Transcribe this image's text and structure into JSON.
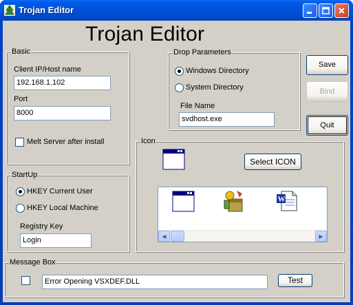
{
  "window": {
    "title": "Trojan Editor"
  },
  "header": {
    "title": "Trojan Editor"
  },
  "basic": {
    "group_label": "Basic",
    "host_label": "Client IP/Host name",
    "host_value": "192.168.1.102",
    "port_label": "Port",
    "port_value": "8000",
    "melt_label": "Melt Server after install",
    "melt_checked": false
  },
  "drop": {
    "group_label": "Drop Parameters",
    "options": [
      "Windows Directory",
      "System Directory"
    ],
    "selected": "Windows Directory",
    "filename_label": "File Name",
    "filename_value": "svdhost.exe"
  },
  "actions": {
    "save": "Save",
    "bind": "Bind",
    "quit": "Quit"
  },
  "startup": {
    "group_label": "StartUp",
    "options": [
      "HKEY Current User",
      "HKEY Local  Machine"
    ],
    "selected": "HKEY Current User",
    "regkey_label": "Registry Key",
    "regkey_value": "Login"
  },
  "icon": {
    "group_label": "Icon",
    "select_button": "Select ICON",
    "current_icon": "window-icon",
    "choices": [
      "window-icon",
      "package-icon",
      "word-document-icon"
    ]
  },
  "message_box": {
    "group_label": "Message Box",
    "enabled": false,
    "message_value": "Error Opening VSXDEF.DLL",
    "test_button": "Test"
  }
}
